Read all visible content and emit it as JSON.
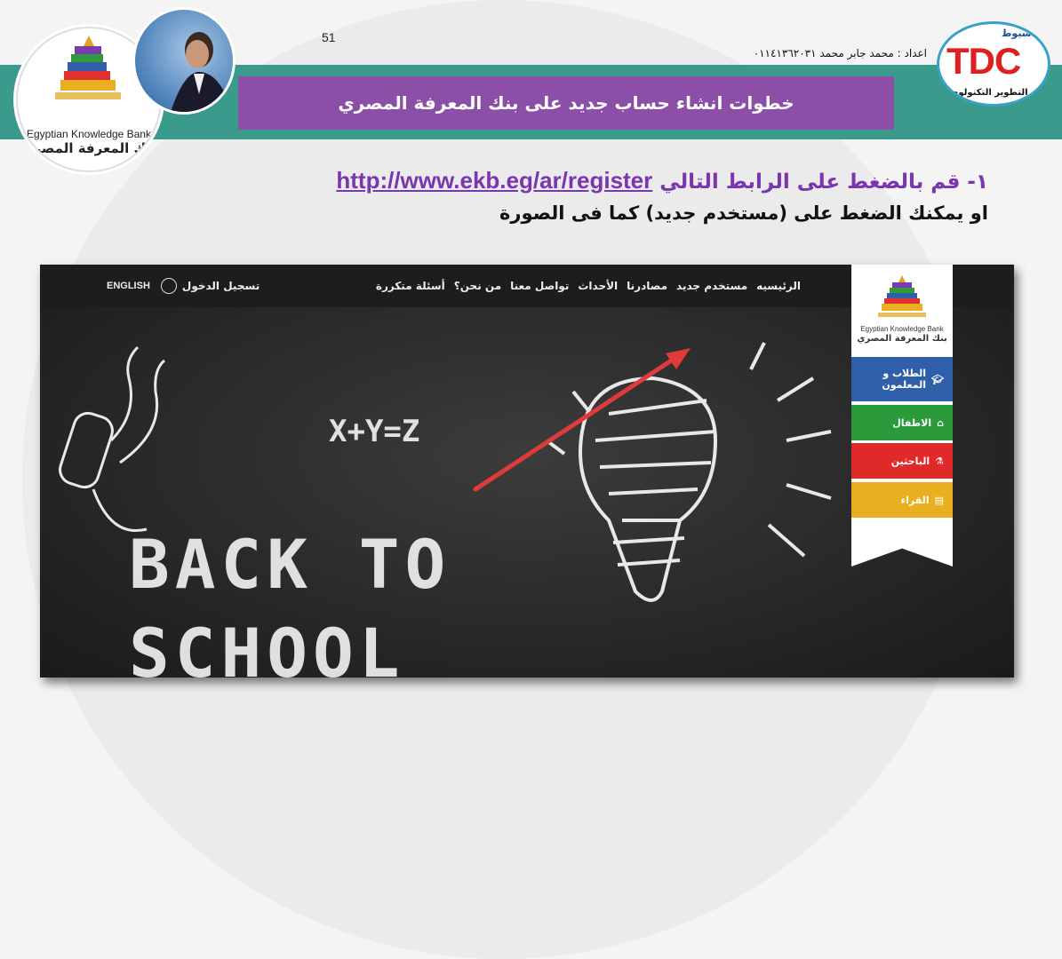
{
  "page": {
    "number": "51",
    "author": "اعداد : محمد جابر محمد ٠١١٤١٣٦٢٠٣١",
    "title": "خطوات انشاء حساب جديد على بنك المعرفة المصري"
  },
  "logos": {
    "ekb_en": "Egyptian Knowledge Bank",
    "ekb_ar": "بنك المعرفة المصري",
    "tdc_main": "TDC",
    "tdc_city": "اسيوط",
    "tdc_name": "مركز التطوير التكنولوجي"
  },
  "instructions": {
    "step1_prefix": "١- قم بالضغط على الرابط التالي",
    "step1_link": "http://www.ekb.eg/ar/register",
    "step2": "او يمكنك الضغط على (مستخدم جديد) كما فى الصورة"
  },
  "website": {
    "nav": [
      "الرئيسيه",
      "مستخدم جديد",
      "مصادرنا",
      "الأحداث",
      "تواصل معنا",
      "من نحن؟",
      "أسئلة متكررة"
    ],
    "login": "تسجيل الدخول",
    "english": "ENGLISH",
    "logo_en": "Egyptian Knowledge Bank",
    "logo_ar": "بنك المعرفة المصري",
    "side_items": [
      {
        "label": "الطلاب و المعلمون",
        "color": "#2f5fa8",
        "icon": "graduation-cap-icon"
      },
      {
        "label": "الاطفال",
        "color": "#2a9a3a",
        "icon": "house-icon"
      },
      {
        "label": "الباحثين",
        "color": "#e02a2a",
        "icon": "microscope-icon"
      },
      {
        "label": "القراء",
        "color": "#e8b020",
        "icon": "book-icon"
      }
    ],
    "chalk": {
      "equation": "X+Y=Z",
      "line1": "BACK TO",
      "line2": "SCHOOL"
    }
  },
  "colors": {
    "title_bar": "#8b4fa8",
    "band": "#3a9a8c",
    "arrow": "#e03a3a",
    "link": "#7a35b0"
  }
}
